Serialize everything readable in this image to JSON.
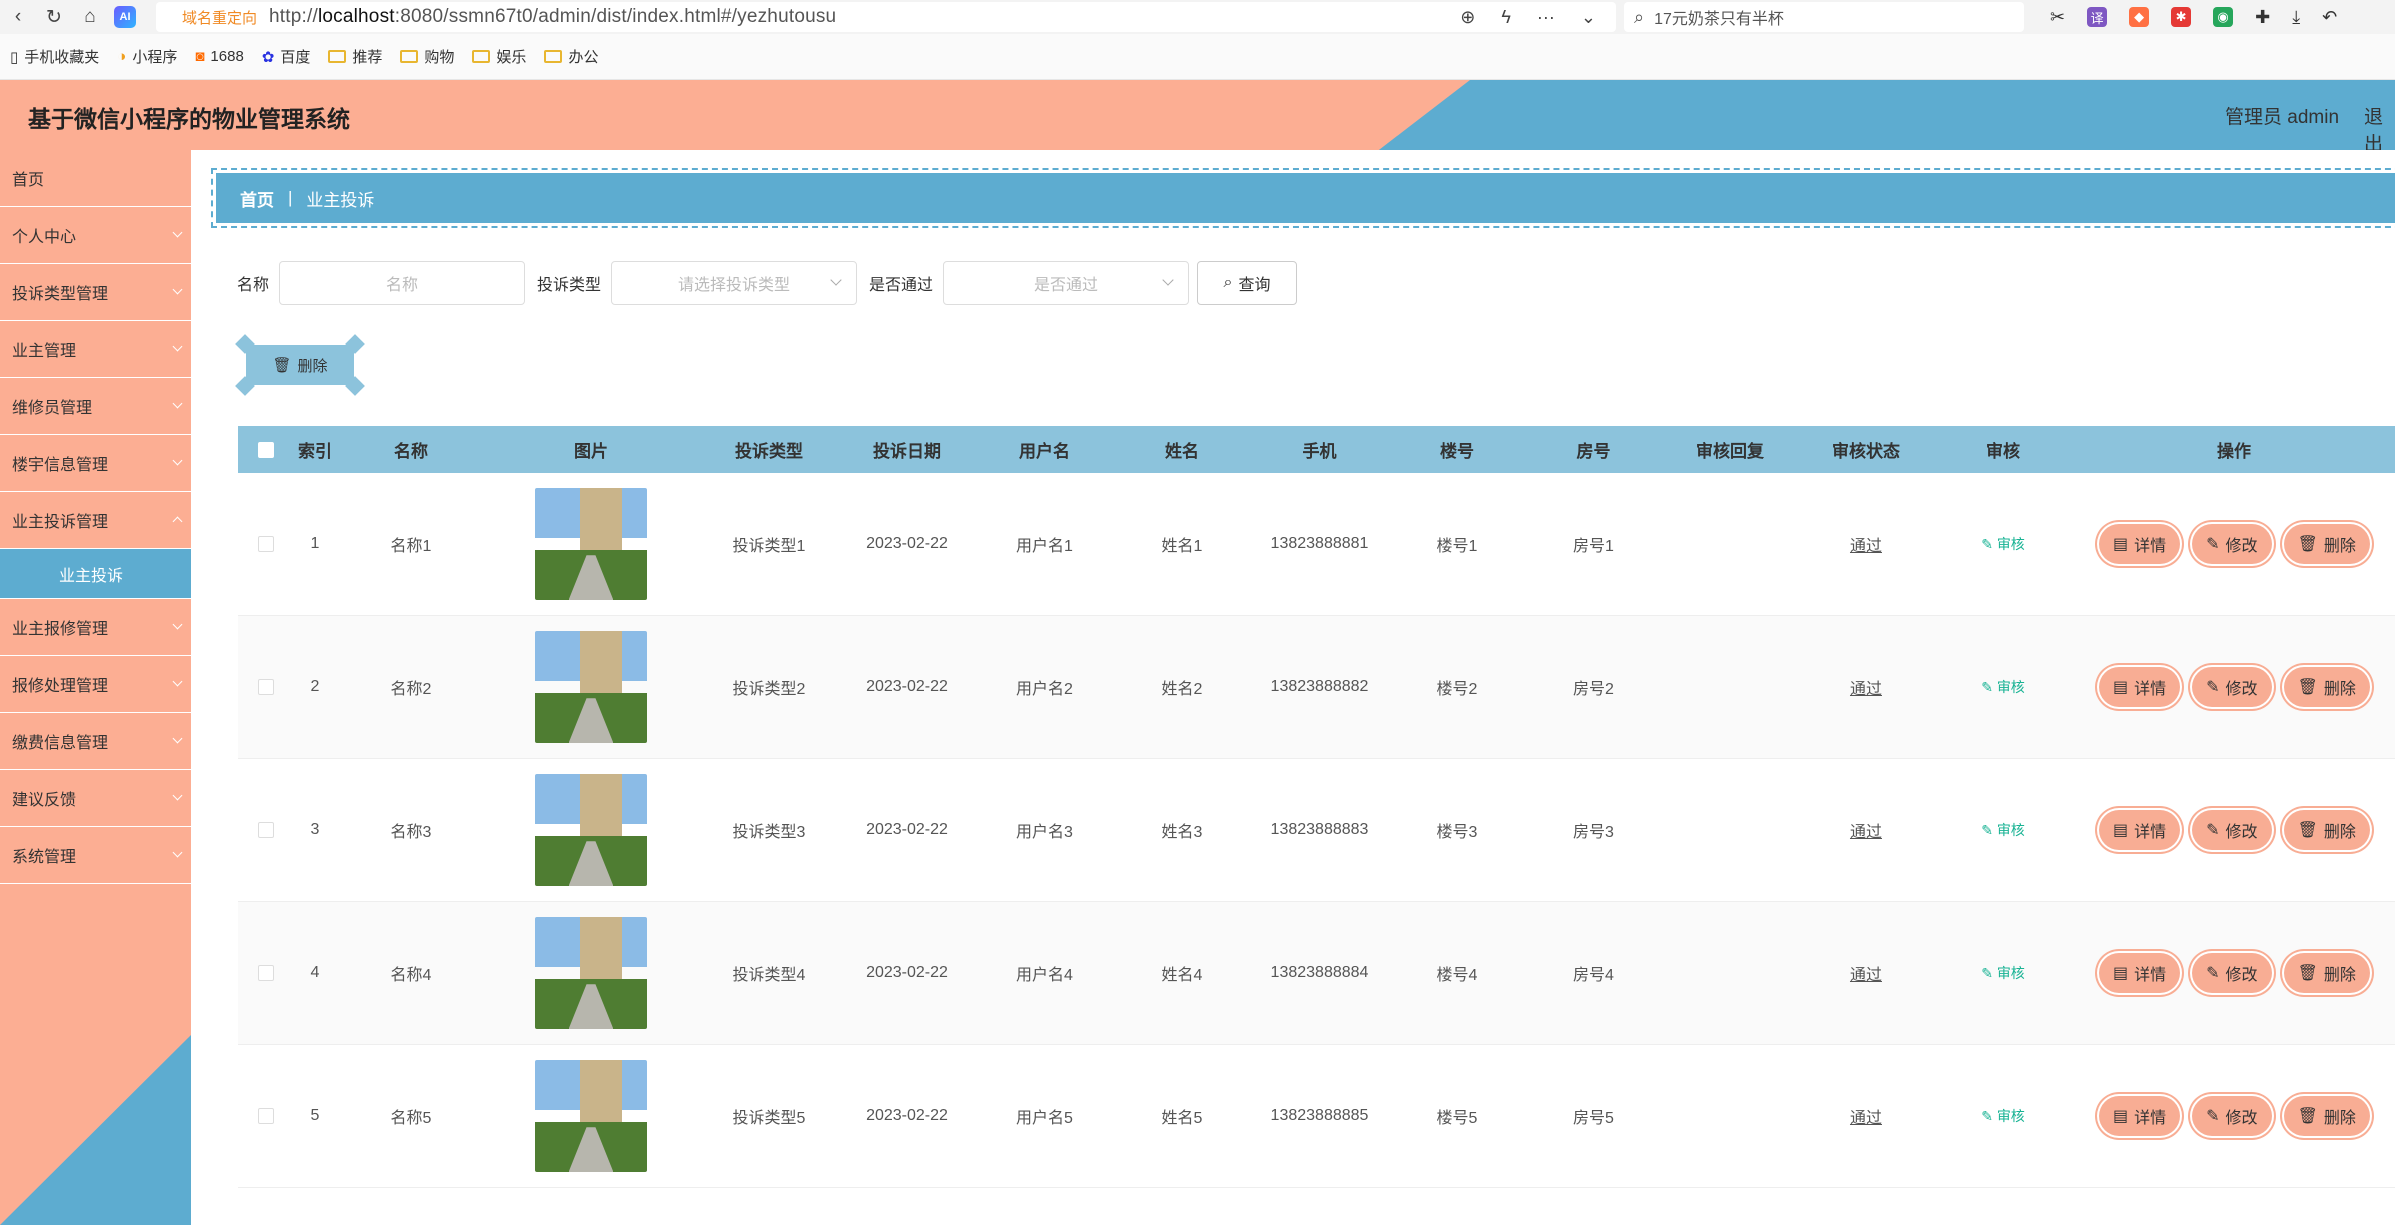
{
  "browser": {
    "redirect_tag": "域名重定向",
    "url_prefix": "http://",
    "url_host": "localhost",
    "url_rest": ":8080/ssmn67t0/admin/dist/index.html#/yezhutousu",
    "search_text": "17元奶茶只有半杯",
    "bookmarks": [
      "手机收藏夹",
      "小程序",
      "1688",
      "百度",
      "推荐",
      "购物",
      "娱乐",
      "办公"
    ]
  },
  "header": {
    "title": "基于微信小程序的物业管理系统",
    "user": "管理员 admin",
    "logout": "退出"
  },
  "sidebar": {
    "items": [
      {
        "label": "首页"
      },
      {
        "label": "个人中心"
      },
      {
        "label": "投诉类型管理"
      },
      {
        "label": "业主管理"
      },
      {
        "label": "维修员管理"
      },
      {
        "label": "楼宇信息管理"
      },
      {
        "label": "业主投诉管理"
      },
      {
        "label": "业主投诉"
      },
      {
        "label": "业主报修管理"
      },
      {
        "label": "报修处理管理"
      },
      {
        "label": "缴费信息管理"
      },
      {
        "label": "建议反馈"
      },
      {
        "label": "系统管理"
      }
    ]
  },
  "breadcrumb": {
    "home": "首页",
    "current": "业主投诉"
  },
  "search": {
    "name_label": "名称",
    "name_placeholder": "名称",
    "type_label": "投诉类型",
    "type_placeholder": "请选择投诉类型",
    "pass_label": "是否通过",
    "pass_placeholder": "是否通过",
    "query_button": "查询"
  },
  "batch_delete": "删除",
  "table": {
    "headers": [
      "索引",
      "名称",
      "图片",
      "投诉类型",
      "投诉日期",
      "用户名",
      "姓名",
      "手机",
      "楼号",
      "房号",
      "审核回复",
      "审核状态",
      "审核",
      "操作"
    ],
    "rows": [
      {
        "index": "1",
        "name": "名称1",
        "type": "投诉类型1",
        "date": "2023-02-22",
        "username": "用户名1",
        "realname": "姓名1",
        "phone": "13823888881",
        "building": "楼号1",
        "room": "房号1",
        "reply": "",
        "status": "通过"
      },
      {
        "index": "2",
        "name": "名称2",
        "type": "投诉类型2",
        "date": "2023-02-22",
        "username": "用户名2",
        "realname": "姓名2",
        "phone": "13823888882",
        "building": "楼号2",
        "room": "房号2",
        "reply": "",
        "status": "通过"
      },
      {
        "index": "3",
        "name": "名称3",
        "type": "投诉类型3",
        "date": "2023-02-22",
        "username": "用户名3",
        "realname": "姓名3",
        "phone": "13823888883",
        "building": "楼号3",
        "room": "房号3",
        "reply": "",
        "status": "通过"
      },
      {
        "index": "4",
        "name": "名称4",
        "type": "投诉类型4",
        "date": "2023-02-22",
        "username": "用户名4",
        "realname": "姓名4",
        "phone": "13823888884",
        "building": "楼号4",
        "room": "房号4",
        "reply": "",
        "status": "通过"
      },
      {
        "index": "5",
        "name": "名称5",
        "type": "投诉类型5",
        "date": "2023-02-22",
        "username": "用户名5",
        "realname": "姓名5",
        "phone": "13823888885",
        "building": "楼号5",
        "room": "房号5",
        "reply": "",
        "status": "通过"
      }
    ],
    "audit_label": "审核",
    "detail_label": "详情",
    "edit_label": "修改",
    "delete_label": "删除"
  },
  "colors": {
    "salmon": "#fcae93",
    "blue": "#5dacd0",
    "light_blue": "#8cc3dc",
    "audit_green": "#19b394"
  }
}
